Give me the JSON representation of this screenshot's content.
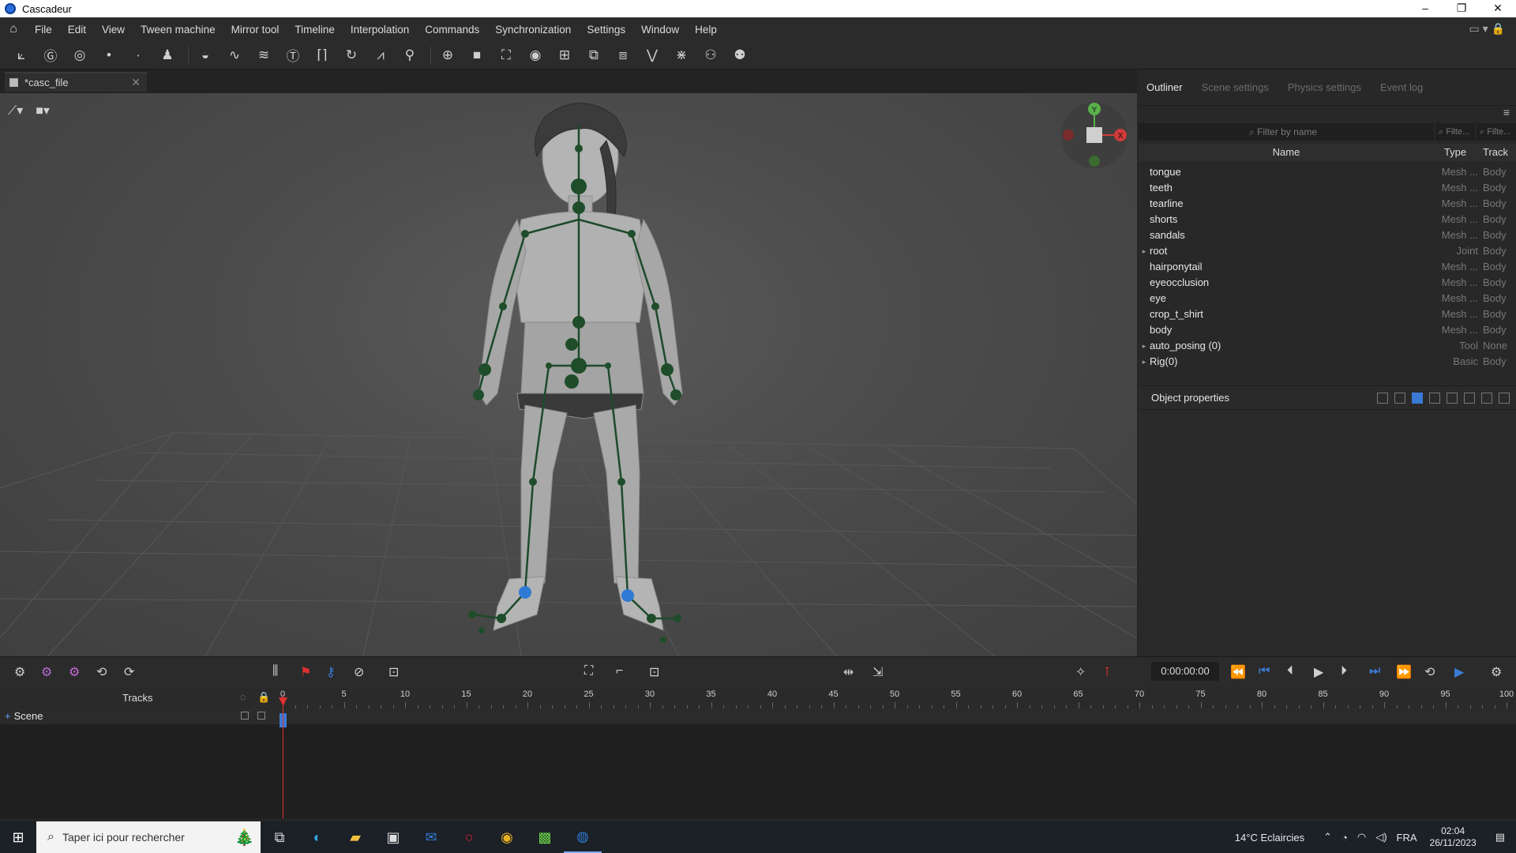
{
  "window": {
    "title": "Cascadeur",
    "controls": [
      "–",
      "❐",
      "✕"
    ]
  },
  "menu": [
    "File",
    "Edit",
    "View",
    "Tween machine",
    "Mirror tool",
    "Timeline",
    "Interpolation",
    "Commands",
    "Synchronization",
    "Settings",
    "Window",
    "Help"
  ],
  "doc_tab": {
    "label": "*casc_file"
  },
  "right_panel": {
    "tabs": [
      "Outliner",
      "Scene settings",
      "Physics settings",
      "Event log"
    ],
    "filter_placeholder": "Filter by name",
    "filter_small": "Filte...",
    "columns": {
      "name": "Name",
      "type": "Type",
      "track": "Track"
    },
    "rows": [
      {
        "name": "tongue",
        "type": "Mesh ...",
        "track": "Body",
        "expand": ""
      },
      {
        "name": "teeth",
        "type": "Mesh ...",
        "track": "Body",
        "expand": ""
      },
      {
        "name": "tearline",
        "type": "Mesh ...",
        "track": "Body",
        "expand": ""
      },
      {
        "name": "shorts",
        "type": "Mesh ...",
        "track": "Body",
        "expand": ""
      },
      {
        "name": "sandals",
        "type": "Mesh ...",
        "track": "Body",
        "expand": ""
      },
      {
        "name": "root",
        "type": "Joint",
        "track": "Body",
        "expand": "▸"
      },
      {
        "name": "hairponytail",
        "type": "Mesh ...",
        "track": "Body",
        "expand": ""
      },
      {
        "name": "eyeocclusion",
        "type": "Mesh ...",
        "track": "Body",
        "expand": ""
      },
      {
        "name": "eye",
        "type": "Mesh ...",
        "track": "Body",
        "expand": ""
      },
      {
        "name": "crop_t_shirt",
        "type": "Mesh ...",
        "track": "Body",
        "expand": ""
      },
      {
        "name": "body",
        "type": "Mesh ...",
        "track": "Body",
        "expand": ""
      },
      {
        "name": "auto_posing (0)",
        "type": "Tool",
        "track": "None",
        "expand": "▸"
      },
      {
        "name": "Rig(0)",
        "type": "Basic",
        "track": "Body",
        "expand": "▸"
      }
    ],
    "object_properties": "Object properties"
  },
  "gizmo": {
    "y": "Y",
    "x": "X"
  },
  "timeline": {
    "timecode": "0:00:00:00",
    "tracks_label": "Tracks",
    "scene_label": "Scene",
    "ticks": [
      "0",
      "5",
      "10",
      "15",
      "20",
      "25",
      "30",
      "35",
      "40",
      "45",
      "50",
      "55",
      "60",
      "65",
      "70",
      "75",
      "80",
      "85",
      "90",
      "95",
      "100"
    ]
  },
  "taskbar": {
    "search_placeholder": "Taper ici pour rechercher",
    "weather": "14°C  Eclaircies",
    "lang": "FRA",
    "time": "02:04",
    "date": "26/11/2023"
  },
  "colors": {
    "accent": "#3b7ad4",
    "playhead": "#e03030",
    "joint": "#1f4d2a"
  }
}
